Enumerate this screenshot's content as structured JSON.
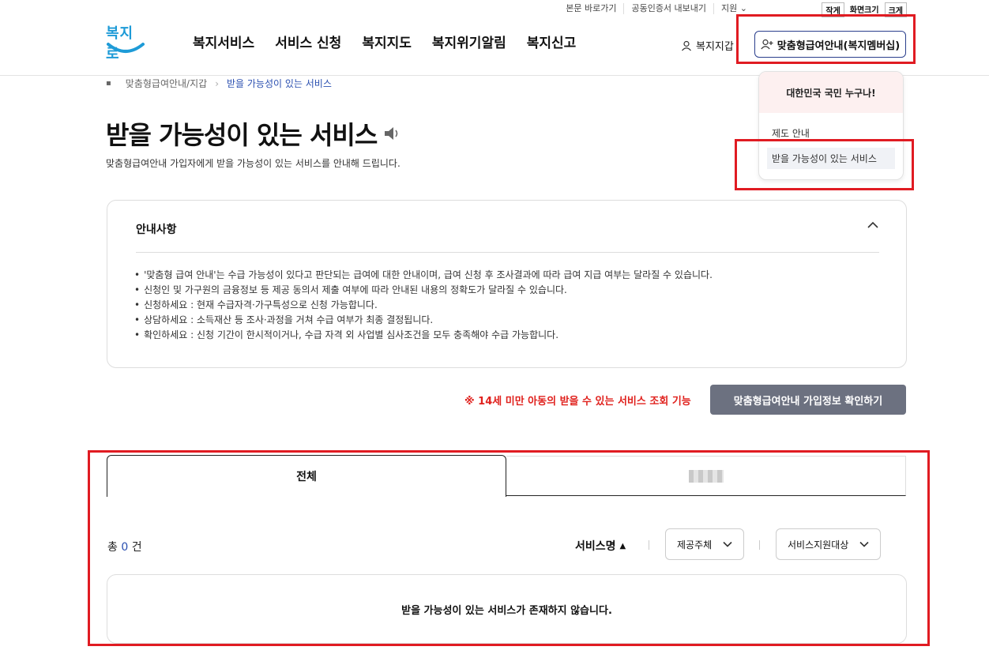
{
  "header": {
    "util_links": [
      "본문 바로가기",
      "공동인증서 내보내기",
      "지원 ⌄"
    ],
    "font_size": {
      "small": "작게",
      "label": "화면크기",
      "large": "크게"
    },
    "logo_text": "복지로",
    "gnb": [
      "복지서비스",
      "서비스 신청",
      "복지지도",
      "복지위기알림",
      "복지신고"
    ],
    "wallet": "복지지갑",
    "my_button": "맞춤형급여안내(복지멤버십)"
  },
  "dropdown": {
    "header": "대한민국 국민 누구나!",
    "items": [
      "제도 안내",
      "받을 가능성이 있는 서비스"
    ]
  },
  "breadcrumb": [
    "맞춤형급여안내/지갑",
    "받을 가능성이 있는 서비스"
  ],
  "page": {
    "title": "받을 가능성이 있는 서비스",
    "subtitle": "맞춤형급여안내 가입자에게 받을 가능성이 있는 서비스를 안내해 드립니다."
  },
  "notice": {
    "heading": "안내사항",
    "items": [
      "'맞춤형 급여 안내'는 수급 가능성이 있다고 판단되는 급여에 대한 안내이며, 급여 신청 후 조사결과에 따라 급여 지급 여부는 달라질 수 있습니다.",
      "신청인 및 가구원의 금융정보 등 제공 동의서 제출 여부에 따라 안내된 내용의 정확도가 달라질 수 있습니다.",
      "신청하세요 : 현재 수급자격·가구특성으로 신청 가능합니다.",
      "상담하세요 : 소득재산 등 조사·과정을 거쳐 수급 여부가 최종 결정됩니다.",
      "확인하세요 : 신청 기간이 한시적이거나, 수급 자격 외 사업별 심사조건을 모두 충족해야 수급 가능합니다."
    ]
  },
  "warning": "※ 14세 미만 아동의 받을 수 있는 서비스 조회 기능",
  "check_button": "맞춤형급여안내 가입정보 확인하기",
  "tabs": [
    "전체"
  ],
  "list": {
    "count_prefix": "총 ",
    "count": "0",
    "count_suffix": " 건",
    "sort_label": "서비스명",
    "filter1": "제공주체",
    "filter2": "서비스지원대상",
    "empty_message": "받을 가능성이 있는 서비스가 존재하지 않습니다."
  }
}
